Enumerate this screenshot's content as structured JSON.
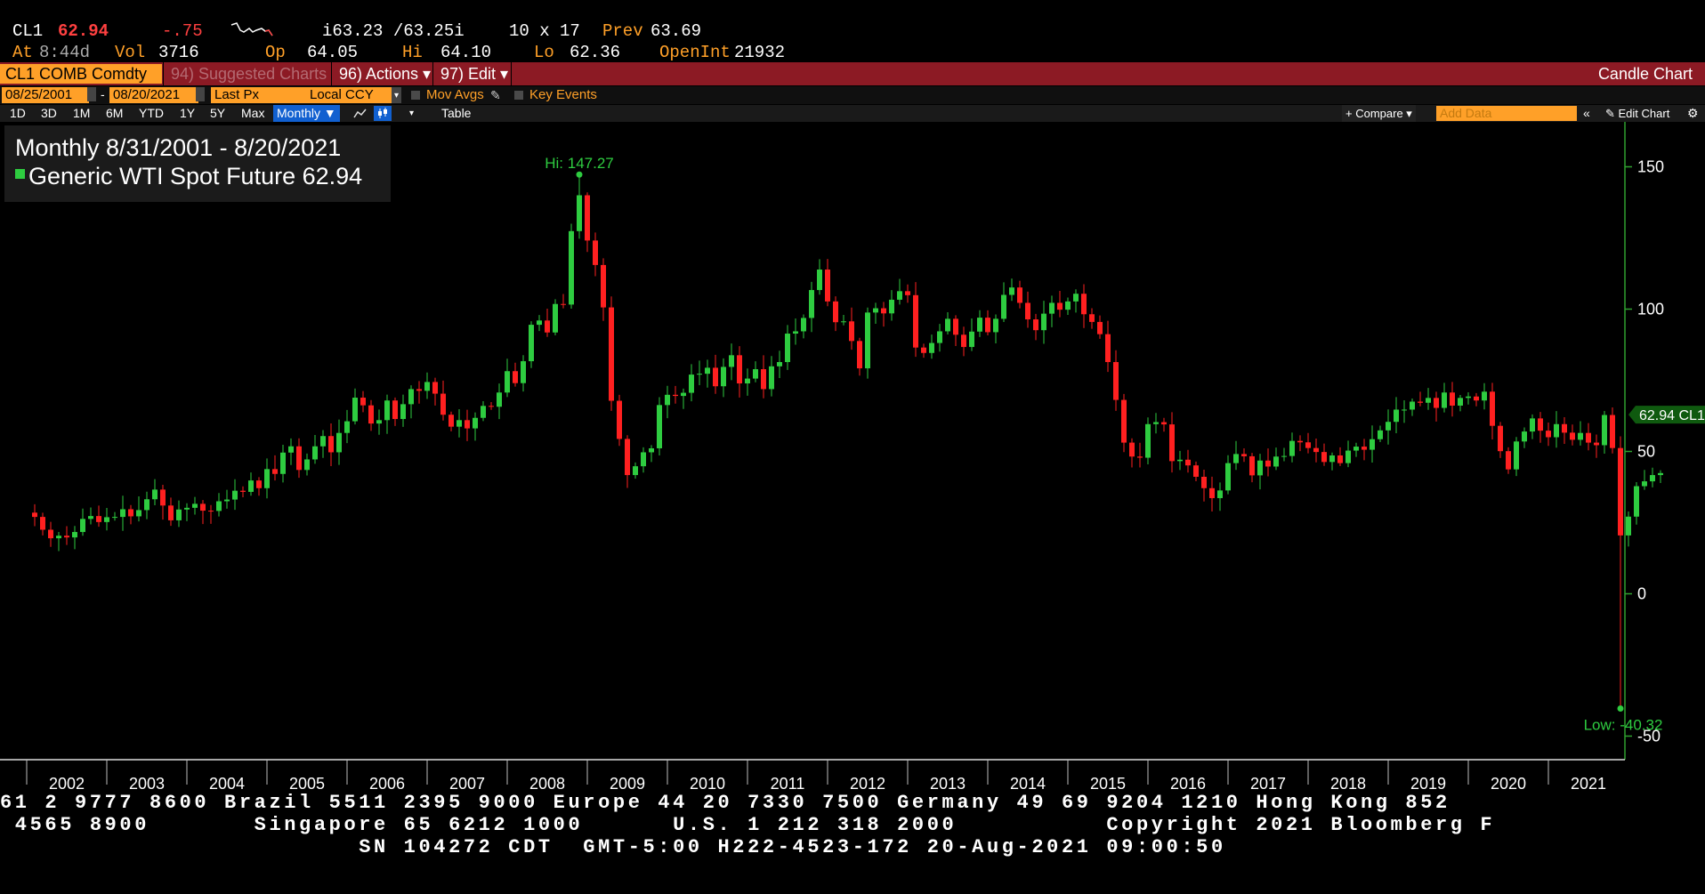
{
  "quote": {
    "ticker": "CL1",
    "last": "62.94",
    "change": "-.75",
    "bid_ask": "i63.23 /63.25i",
    "size": "10 x 17",
    "prev_label": "Prev",
    "prev": "63.69",
    "at_label": "At",
    "at_time": "8:44d",
    "vol_label": "Vol",
    "vol": "3716",
    "op_label": "Op",
    "op": "64.05",
    "hi_label": "Hi",
    "hi": "64.10",
    "lo_label": "Lo",
    "lo": "62.36",
    "openint_label": "OpenInt",
    "openint": "21932"
  },
  "toolbar": {
    "security": "CL1 COMB Comdty",
    "suggested": "94) Suggested Charts",
    "actions": "96) Actions ▾",
    "edit": "97) Edit ▾",
    "title": "Candle Chart"
  },
  "controls": {
    "start_date": "08/25/2001",
    "end_date": "08/20/2021",
    "field": "Last Px",
    "currency": "Local CCY",
    "mov_avgs": "Mov Avgs",
    "key_events": "Key Events",
    "periods": [
      "1D",
      "3D",
      "1M",
      "6M",
      "YTD",
      "1Y",
      "5Y",
      "Max"
    ],
    "frequency": "Monthly ▼",
    "table": "Table",
    "compare": "+ Compare ▾",
    "add_data_placeholder": "Add Data",
    "edit_chart": "✎ Edit Chart"
  },
  "colors": {
    "up": "#2ecc40",
    "down": "#ff2020",
    "axis": "#2fa02f",
    "accent": "#ffa028",
    "toolbar": "#8c1a24"
  },
  "chart_data": {
    "type": "candlestick",
    "legend_title": "Monthly 8/31/2001 - 8/20/2021",
    "series_name": "Generic WTI Spot Future 62.94",
    "x_labels": [
      "2002",
      "2003",
      "2004",
      "2005",
      "2006",
      "2007",
      "2008",
      "2009",
      "2010",
      "2011",
      "2012",
      "2013",
      "2014",
      "2015",
      "2016",
      "2017",
      "2018",
      "2019",
      "2020",
      "2021"
    ],
    "y_ticks": [
      150,
      100,
      50,
      0,
      -50
    ],
    "ylim": [
      -56,
      166
    ],
    "last_label": "62.94 CL1",
    "hi_annotation": "Hi: 147.27",
    "hi_value": 147.27,
    "low_annotation": "Low: -40.32",
    "low_value": -40.32,
    "close_points": [
      [
        2001.65,
        27
      ],
      [
        2001.75,
        22.5
      ],
      [
        2001.85,
        19.5
      ],
      [
        2001.95,
        20.4
      ],
      [
        2002.05,
        19.8
      ],
      [
        2002.15,
        21.7
      ],
      [
        2002.25,
        26.3
      ],
      [
        2002.35,
        27.3
      ],
      [
        2002.45,
        25.2
      ],
      [
        2002.55,
        26.9
      ],
      [
        2002.65,
        27
      ],
      [
        2002.75,
        29.7
      ],
      [
        2002.85,
        27.2
      ],
      [
        2002.95,
        29.4
      ],
      [
        2003.05,
        33.2
      ],
      [
        2003.15,
        36.6
      ],
      [
        2003.25,
        31
      ],
      [
        2003.35,
        25.8
      ],
      [
        2003.45,
        29.6
      ],
      [
        2003.55,
        30.2
      ],
      [
        2003.65,
        31.6
      ],
      [
        2003.75,
        29.2
      ],
      [
        2003.85,
        29.1
      ],
      [
        2003.95,
        32.5
      ],
      [
        2004.05,
        33.1
      ],
      [
        2004.15,
        36.2
      ],
      [
        2004.25,
        35.8
      ],
      [
        2004.35,
        39.8
      ],
      [
        2004.45,
        37.1
      ],
      [
        2004.55,
        43.8
      ],
      [
        2004.65,
        42.1
      ],
      [
        2004.75,
        49.6
      ],
      [
        2004.85,
        51.8
      ],
      [
        2004.95,
        43.5
      ],
      [
        2005.05,
        47.2
      ],
      [
        2005.15,
        51.8
      ],
      [
        2005.25,
        55.4
      ],
      [
        2005.35,
        49.7
      ],
      [
        2005.45,
        56.5
      ],
      [
        2005.55,
        60.6
      ],
      [
        2005.65,
        68.9
      ],
      [
        2005.75,
        66.2
      ],
      [
        2005.85,
        59.8
      ],
      [
        2005.95,
        61
      ],
      [
        2006.05,
        67.9
      ],
      [
        2006.15,
        61.4
      ],
      [
        2006.25,
        66.6
      ],
      [
        2006.35,
        71.9
      ],
      [
        2006.45,
        71.3
      ],
      [
        2006.55,
        74.4
      ],
      [
        2006.65,
        70.3
      ],
      [
        2006.75,
        62.9
      ],
      [
        2006.85,
        58.7
      ],
      [
        2006.95,
        61
      ],
      [
        2007.05,
        58.1
      ],
      [
        2007.15,
        61.8
      ],
      [
        2007.25,
        66
      ],
      [
        2007.35,
        65.7
      ],
      [
        2007.45,
        70.7
      ],
      [
        2007.55,
        78.2
      ],
      [
        2007.65,
        74
      ],
      [
        2007.75,
        81.7
      ],
      [
        2007.85,
        94.5
      ],
      [
        2007.95,
        96
      ],
      [
        2008.05,
        91.8
      ],
      [
        2008.15,
        101.8
      ],
      [
        2008.25,
        101.6
      ],
      [
        2008.35,
        127.4
      ],
      [
        2008.45,
        140
      ],
      [
        2008.55,
        124.1
      ],
      [
        2008.65,
        115.5
      ],
      [
        2008.75,
        100.6
      ],
      [
        2008.85,
        67.8
      ],
      [
        2008.95,
        54.4
      ],
      [
        2009.05,
        41.7
      ],
      [
        2009.15,
        44.8
      ],
      [
        2009.25,
        49.7
      ],
      [
        2009.35,
        51.1
      ],
      [
        2009.45,
        66.3
      ],
      [
        2009.55,
        69.9
      ],
      [
        2009.65,
        69.5
      ],
      [
        2009.75,
        70.6
      ],
      [
        2009.85,
        77
      ],
      [
        2009.95,
        77.3
      ],
      [
        2010.05,
        79.4
      ],
      [
        2010.15,
        72.9
      ],
      [
        2010.25,
        79.7
      ],
      [
        2010.35,
        83.8
      ],
      [
        2010.45,
        73.9
      ],
      [
        2010.55,
        75.6
      ],
      [
        2010.65,
        78.9
      ],
      [
        2010.75,
        71.9
      ],
      [
        2010.85,
        79.9
      ],
      [
        2010.95,
        81.4
      ],
      [
        2011.05,
        91.4
      ],
      [
        2011.15,
        92.2
      ],
      [
        2011.25,
        96.9
      ],
      [
        2011.35,
        106.7
      ],
      [
        2011.45,
        113.9
      ],
      [
        2011.55,
        102.7
      ],
      [
        2011.65,
        95.4
      ],
      [
        2011.75,
        95.7
      ],
      [
        2011.85,
        88.8
      ],
      [
        2011.95,
        79.2
      ],
      [
        2012.05,
        98.8
      ],
      [
        2012.15,
        100.3
      ],
      [
        2012.25,
        98.5
      ],
      [
        2012.35,
        103.3
      ],
      [
        2012.45,
        106.3
      ],
      [
        2012.55,
        104.9
      ],
      [
        2012.65,
        86.5
      ],
      [
        2012.75,
        84.6
      ],
      [
        2012.85,
        88.1
      ],
      [
        2012.95,
        92.2
      ],
      [
        2013.05,
        96.6
      ],
      [
        2013.15,
        91
      ],
      [
        2013.25,
        86.7
      ],
      [
        2013.35,
        92.1
      ],
      [
        2013.45,
        97
      ],
      [
        2013.55,
        91.9
      ],
      [
        2013.65,
        96.6
      ],
      [
        2013.75,
        105
      ],
      [
        2013.85,
        107.6
      ],
      [
        2013.95,
        102.2
      ],
      [
        2014.05,
        96.4
      ],
      [
        2014.15,
        92.6
      ],
      [
        2014.25,
        98.4
      ],
      [
        2014.35,
        102.2
      ],
      [
        2014.45,
        99.8
      ],
      [
        2014.55,
        102.7
      ],
      [
        2014.65,
        105.4
      ],
      [
        2014.75,
        98.2
      ],
      [
        2014.85,
        95.5
      ],
      [
        2014.95,
        91.2
      ],
      [
        2015.05,
        81.4
      ],
      [
        2015.15,
        68.1
      ],
      [
        2015.25,
        53.1
      ],
      [
        2015.35,
        48.2
      ],
      [
        2015.45,
        47.8
      ],
      [
        2015.55,
        59.6
      ],
      [
        2015.65,
        60.3
      ],
      [
        2015.75,
        59.5
      ],
      [
        2015.85,
        46.6
      ],
      [
        2015.95,
        47.1
      ],
      [
        2016.05,
        45.1
      ],
      [
        2016.15,
        41.1
      ],
      [
        2016.25,
        37.1
      ],
      [
        2016.35,
        33.6
      ],
      [
        2016.45,
        36.3
      ],
      [
        2016.55,
        45.9
      ],
      [
        2016.65,
        49.1
      ],
      [
        2016.75,
        48.3
      ],
      [
        2016.85,
        41.6
      ],
      [
        2016.95,
        46.8
      ],
      [
        2017.05,
        44.7
      ],
      [
        2017.15,
        48.2
      ],
      [
        2017.25,
        48.4
      ],
      [
        2017.35,
        53.7
      ],
      [
        2017.45,
        53.2
      ],
      [
        2017.55,
        51.2
      ],
      [
        2017.65,
        49.8
      ],
      [
        2017.75,
        46.3
      ],
      [
        2017.85,
        48.6
      ],
      [
        2017.95,
        45.9
      ],
      [
        2018.05,
        50.3
      ],
      [
        2018.15,
        51.7
      ],
      [
        2018.25,
        50.6
      ],
      [
        2018.35,
        54.3
      ],
      [
        2018.45,
        57.4
      ],
      [
        2018.55,
        60.4
      ],
      [
        2018.65,
        64.7
      ],
      [
        2018.75,
        64.7
      ],
      [
        2018.85,
        67.5
      ],
      [
        2018.95,
        67.1
      ],
      [
        2019.05,
        68.8
      ],
      [
        2019.15,
        65.3
      ],
      [
        2019.25,
        70.7
      ],
      [
        2019.35,
        66.1
      ],
      [
        2019.45,
        68.8
      ],
      [
        2019.55,
        69.3
      ],
      [
        2019.65,
        67.9
      ],
      [
        2019.75,
        71
      ],
      [
        2019.85,
        59
      ],
      [
        2019.95,
        50.1
      ],
      [
        2020.05,
        43.7
      ],
      [
        2020.15,
        53.5
      ],
      [
        2020.25,
        57
      ],
      [
        2020.35,
        61.6
      ],
      [
        2020.45,
        57.3
      ],
      [
        2020.55,
        55
      ],
      [
        2020.65,
        59.6
      ],
      [
        2020.75,
        56.6
      ],
      [
        2020.85,
        54.1
      ],
      [
        2020.95,
        56.5
      ],
      [
        2021.05,
        53.1
      ],
      [
        2021.15,
        52.2
      ],
      [
        2021.25,
        62.8
      ],
      [
        2021.35,
        51.2
      ],
      [
        2021.45,
        20.5
      ],
      [
        2021.55,
        27.1
      ],
      [
        2021.65,
        37.8
      ],
      [
        2021.75,
        39.5
      ],
      [
        2021.85,
        41.7
      ],
      [
        2021.95,
        42.4
      ]
    ]
  },
  "footer": {
    "line1": "61 2 9777 8600 Brazil 5511 2395 9000 Europe 44 20 7330 7500 Germany 49 69 9204 1210 Hong Kong 852",
    "line2": " 4565 8900       Singapore 65 6212 1000      U.S. 1 212 318 2000          Copyright 2021 Bloomberg F",
    "line3": "                        SN 104272 CDT  GMT-5:00 H222-4523-172 20-Aug-2021 09:00:50"
  }
}
